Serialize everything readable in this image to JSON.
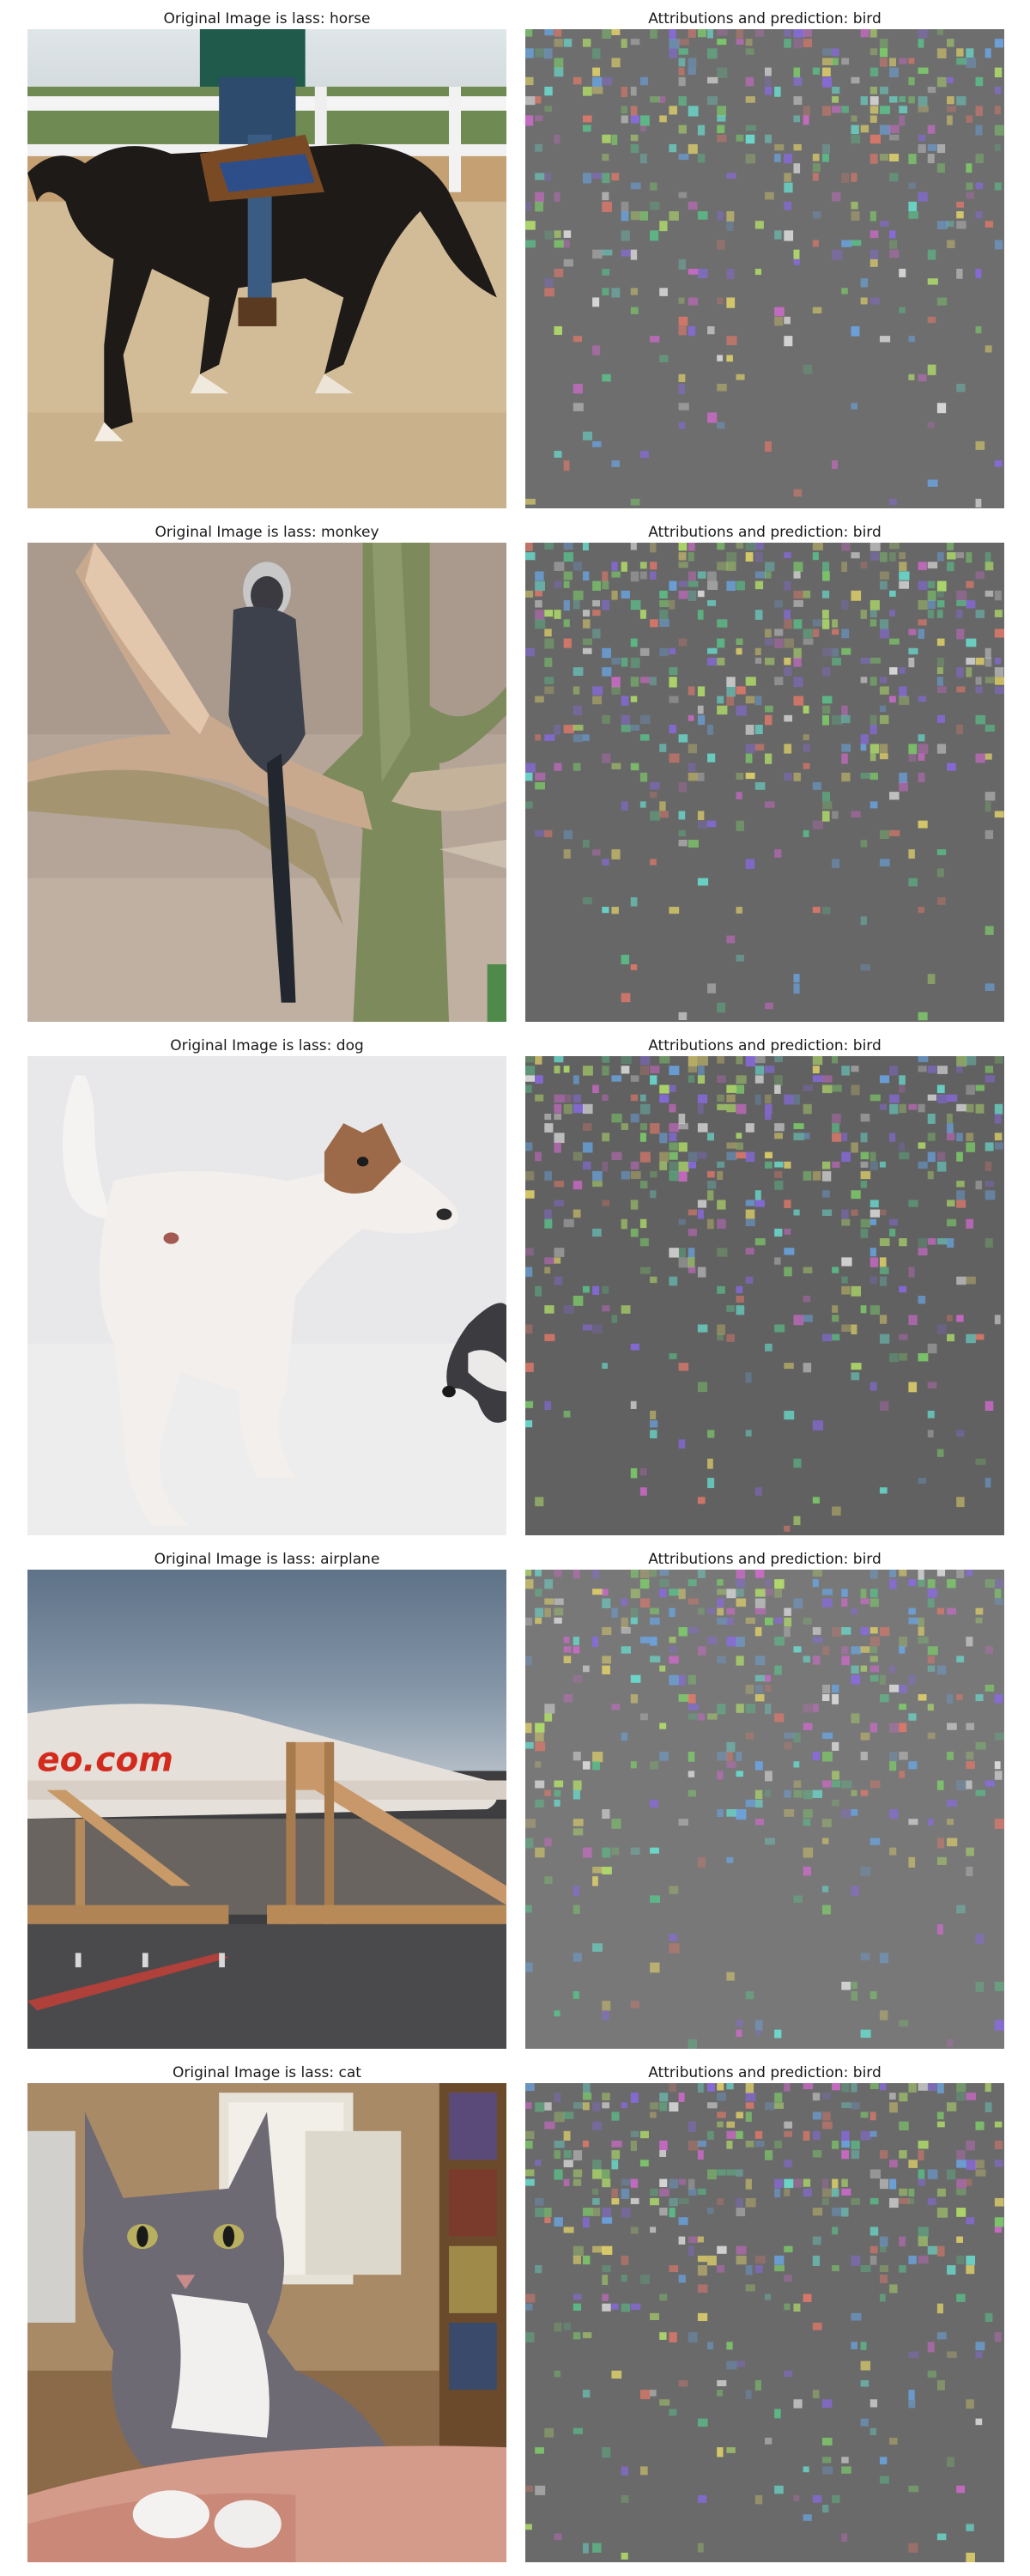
{
  "figure": {
    "rows": [
      {
        "original_title": "Original Image is lass: horse",
        "attribution_title": "Attributions and prediction: bird",
        "original_subject": "horse",
        "attribution_base_color": "#6e6e6e"
      },
      {
        "original_title": "Original Image is lass: monkey",
        "attribution_title": "Attributions and prediction: bird",
        "original_subject": "monkey",
        "attribution_base_color": "#676767"
      },
      {
        "original_title": "Original Image is lass: dog",
        "attribution_title": "Attributions and prediction: bird",
        "original_subject": "dog",
        "attribution_base_color": "#616161"
      },
      {
        "original_title": "Original Image is lass: airplane",
        "attribution_title": "Attributions and prediction: bird",
        "original_subject": "airplane",
        "attribution_base_color": "#787878"
      },
      {
        "original_title": "Original Image is lass: cat",
        "attribution_title": "Attributions and prediction: bird",
        "original_subject": "cat",
        "attribution_base_color": "#6a6a6a"
      }
    ]
  }
}
